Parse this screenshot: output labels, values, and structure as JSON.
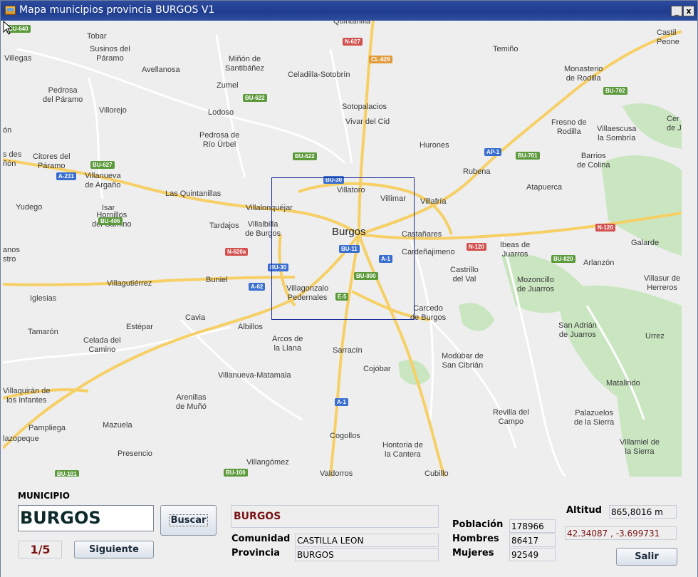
{
  "window": {
    "title": "Mapa municipios provincia BURGOS V1",
    "minimize_glyph": "_",
    "close_glyph": "x"
  },
  "map": {
    "places": [
      {
        "id": "tobar",
        "text": "Tobar"
      },
      {
        "id": "villegas",
        "text": "Villegas"
      },
      {
        "id": "susinos",
        "text": "Susinos del\nPáramo"
      },
      {
        "id": "avellanosa",
        "text": "Avellanosa"
      },
      {
        "id": "minon",
        "text": "Miñón de\nSantibáñez"
      },
      {
        "id": "celadilla",
        "text": "Celadilla-Sotobrín"
      },
      {
        "id": "quintanilla",
        "text": "Quintanilla"
      },
      {
        "id": "temino",
        "text": "Temiño"
      },
      {
        "id": "castil",
        "text": "Castil\nPeone"
      },
      {
        "id": "pedrosa_paramo",
        "text": "Pedrosa\ndel Páramo"
      },
      {
        "id": "zumel",
        "text": "Zumel"
      },
      {
        "id": "sotopalacios",
        "text": "Sotopalacios"
      },
      {
        "id": "vivar",
        "text": "Vivar del Cid"
      },
      {
        "id": "monasterio",
        "text": "Monasterio\nde Rodilla"
      },
      {
        "id": "villorejo",
        "text": "Villorejo"
      },
      {
        "id": "lodoso",
        "text": "Lodoso"
      },
      {
        "id": "pedrosa_rio",
        "text": "Pedrosa de\nRío Úrbel"
      },
      {
        "id": "hurones",
        "text": "Hurones"
      },
      {
        "id": "fresno",
        "text": "Fresno de\nRodilla"
      },
      {
        "id": "villaescusa",
        "text": "Villaescusa\nla Sombría"
      },
      {
        "id": "cer",
        "text": "Cer\nde J"
      },
      {
        "id": "on",
        "text": "ón"
      },
      {
        "id": "citores",
        "text": "Citores del\nPáramo"
      },
      {
        "id": "des",
        "text": "s des\nñón"
      },
      {
        "id": "villanueva_argano",
        "text": "Villanueva\nde Argaño"
      },
      {
        "id": "las_quintanillas",
        "text": "Las Quintanillas"
      },
      {
        "id": "rubena",
        "text": "Rubena"
      },
      {
        "id": "barrios",
        "text": "Barrios\nde Colina"
      },
      {
        "id": "atapuerca",
        "text": "Atapuerca"
      },
      {
        "id": "villatoro",
        "text": "Villatoro"
      },
      {
        "id": "villimar",
        "text": "Villimar"
      },
      {
        "id": "villafria",
        "text": "Villafría"
      },
      {
        "id": "yudego",
        "text": "Yudego"
      },
      {
        "id": "isar",
        "text": "Isar"
      },
      {
        "id": "villalonquejar",
        "text": "Villalonquéjar"
      },
      {
        "id": "hornillos",
        "text": "Hornillos\ndel Camino"
      },
      {
        "id": "tardajos",
        "text": "Tardajos"
      },
      {
        "id": "villalbilla",
        "text": "Villalbilla\nde Burgos"
      },
      {
        "id": "burgos",
        "text": "Burgos"
      },
      {
        "id": "castanares",
        "text": "Castañares"
      },
      {
        "id": "ibeas",
        "text": "Ibeas de\nJuarros"
      },
      {
        "id": "galarde",
        "text": "Galarde"
      },
      {
        "id": "anos",
        "text": "anos\nstro"
      },
      {
        "id": "cardenajimeno",
        "text": "Cardeñajimeno"
      },
      {
        "id": "arlanzon",
        "text": "Arlanzón"
      },
      {
        "id": "castrillo",
        "text": "Castrillo\ndel Val"
      },
      {
        "id": "villagutierrez",
        "text": "Villagutiérrez"
      },
      {
        "id": "buniel",
        "text": "Buniel"
      },
      {
        "id": "mozoncillo",
        "text": "Mozoncillo\nde Juarros"
      },
      {
        "id": "villasur",
        "text": "Villasur de\nHerreros"
      },
      {
        "id": "villagonzalo",
        "text": "Villagonzalo\nPedernales"
      },
      {
        "id": "iglesias",
        "text": "Iglesias"
      },
      {
        "id": "carcedo",
        "text": "Carcedo\nde Burgos"
      },
      {
        "id": "cavia",
        "text": "Cavia"
      },
      {
        "id": "estepar",
        "text": "Estépar"
      },
      {
        "id": "albillos",
        "text": "Albillos"
      },
      {
        "id": "san_adrian",
        "text": "San Adrián\nde Juarros"
      },
      {
        "id": "tamaron",
        "text": "Tamarón"
      },
      {
        "id": "urrez",
        "text": "Urrez"
      },
      {
        "id": "celada",
        "text": "Celada del\nCamino"
      },
      {
        "id": "arcos",
        "text": "Arcos de\nla Llana"
      },
      {
        "id": "sarracin",
        "text": "Sarracín"
      },
      {
        "id": "modubar",
        "text": "Modúbar de\nSan Cibrián"
      },
      {
        "id": "cojobar",
        "text": "Cojóbar"
      },
      {
        "id": "villanueva_matamala",
        "text": "Villanueva-Matamala"
      },
      {
        "id": "matalindo",
        "text": "Matalindo"
      },
      {
        "id": "villaquiran",
        "text": "Villaquirán de\nlos Infantes"
      },
      {
        "id": "arenillas",
        "text": "Arenillas\nde Muñó"
      },
      {
        "id": "revilla",
        "text": "Revilla del\nCampo"
      },
      {
        "id": "palazuelos",
        "text": "Palazuelos\nde la Sierra"
      },
      {
        "id": "pampliega",
        "text": "Pampliega"
      },
      {
        "id": "mazuela",
        "text": "Mazuela"
      },
      {
        "id": "cogollos",
        "text": "Cogollos"
      },
      {
        "id": "hontoria",
        "text": "Hontoria de\nla Cantera"
      },
      {
        "id": "villamiel",
        "text": "Villamiel de\nla Sierra"
      },
      {
        "id": "lazopeque",
        "text": "lazopeque"
      },
      {
        "id": "presencio",
        "text": "Presencio"
      },
      {
        "id": "villangomez",
        "text": "Villangómez"
      },
      {
        "id": "valdorros",
        "text": "Valdorros"
      },
      {
        "id": "cubillo",
        "text": "Cubillo"
      }
    ],
    "shields": [
      {
        "id": "bu640",
        "text": "BU-640",
        "color": "g"
      },
      {
        "id": "n627",
        "text": "N-627",
        "color": "r"
      },
      {
        "id": "cl629",
        "text": "CL-629",
        "color": "o"
      },
      {
        "id": "bu622a",
        "text": "BU-622",
        "color": "g"
      },
      {
        "id": "bu702",
        "text": "BU-702",
        "color": "g"
      },
      {
        "id": "ap1",
        "text": "AP-1",
        "color": "b"
      },
      {
        "id": "bu701",
        "text": "BU-701",
        "color": "g"
      },
      {
        "id": "bu622b",
        "text": "BU-622",
        "color": "g"
      },
      {
        "id": "bu627",
        "text": "BU-627",
        "color": "g"
      },
      {
        "id": "a231",
        "text": "A-231",
        "color": "b"
      },
      {
        "id": "bu30a",
        "text": "BU-30",
        "color": "b"
      },
      {
        "id": "bu406",
        "text": "BU-406",
        "color": "g"
      },
      {
        "id": "n120a",
        "text": "N-120",
        "color": "r"
      },
      {
        "id": "n620a",
        "text": "N-620a",
        "color": "r"
      },
      {
        "id": "bu11",
        "text": "BU-11",
        "color": "b"
      },
      {
        "id": "a1a",
        "text": "A-1",
        "color": "b"
      },
      {
        "id": "n120b",
        "text": "N-120",
        "color": "r"
      },
      {
        "id": "bu820",
        "text": "BU-820",
        "color": "g"
      },
      {
        "id": "bu30b",
        "text": "BU-30",
        "color": "b"
      },
      {
        "id": "bu800",
        "text": "BU-800",
        "color": "g"
      },
      {
        "id": "a62",
        "text": "A-62",
        "color": "b"
      },
      {
        "id": "e5",
        "text": "E-5",
        "color": "g"
      },
      {
        "id": "a1b",
        "text": "A-1",
        "color": "b"
      },
      {
        "id": "bu101",
        "text": "BU-101",
        "color": "g"
      },
      {
        "id": "bu100",
        "text": "BU-100",
        "color": "g"
      }
    ]
  },
  "panel": {
    "municipio_label": "MUNICIPIO",
    "municipio_value": "BURGOS",
    "buscar_label": "Buscar",
    "counter": "1/5",
    "siguiente_label": "Siguiente",
    "selected_name": "BURGOS",
    "comunidad_label": "Comunidad",
    "comunidad_value": "CASTILLA LEON",
    "provincia_label": "Provincia",
    "provincia_value": "BURGOS",
    "poblacion_label": "Población",
    "poblacion_value": "178966",
    "hombres_label": "Hombres",
    "hombres_value": "86417",
    "mujeres_label": "Mujeres",
    "mujeres_value": "92549",
    "altitud_label": "Altitud",
    "altitud_value": "865,8016 m",
    "coords_value": "42.34087 , -3.699731",
    "salir_label": "Salir"
  },
  "colors": {
    "titlebar": "#1f3c8e",
    "map_bg": "#eeeeee",
    "road_yellow": "#f6cf65",
    "park_green": "#c9e6c0",
    "selection_rect": "#1a2b99",
    "value_red": "#7a1414"
  }
}
